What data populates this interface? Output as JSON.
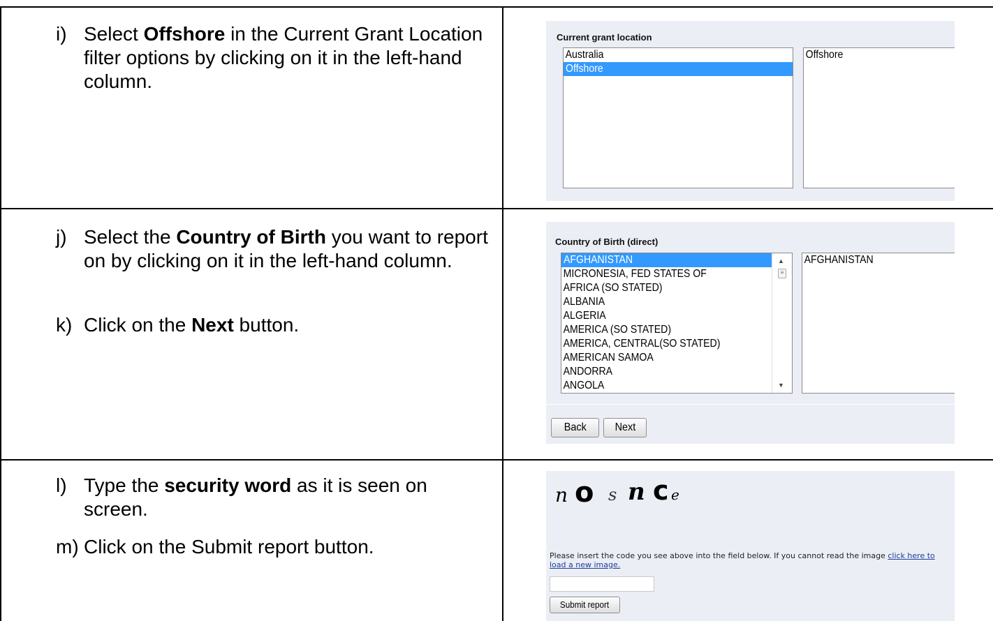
{
  "steps": {
    "i": {
      "label": "i)",
      "pre": "Select ",
      "bold": "Offshore",
      "post": " in the Current Grant Location filter options by clicking on it in the left-hand column."
    },
    "j": {
      "label": "j)",
      "pre": "Select the ",
      "bold": "Country of Birth",
      "post": " you want to report on by clicking on it in the left-hand column."
    },
    "k": {
      "label": "k)",
      "pre": "Click on the ",
      "bold": "Next",
      "post": " button."
    },
    "l": {
      "label": "l)",
      "pre": "Type the ",
      "bold": "security word",
      "post": " as it is seen on screen."
    },
    "m": {
      "label": "m)",
      "text": "Click on the Submit report button."
    }
  },
  "grant_location": {
    "title": "Current grant location",
    "options": [
      "Australia",
      "Offshore"
    ],
    "selected_index": 1,
    "chosen": [
      "Offshore"
    ]
  },
  "country_of_birth": {
    "title": "Country of Birth (direct)",
    "options": [
      "AFGHANISTAN",
      "MICRONESIA, FED STATES OF",
      "AFRICA (SO STATED)",
      "ALBANIA",
      "ALGERIA",
      "AMERICA (SO STATED)",
      "AMERICA, CENTRAL(SO STATED)",
      "AMERICAN SAMOA",
      "ANDORRA",
      "ANGOLA"
    ],
    "selected_index": 0,
    "chosen": [
      "AFGHANISTAN"
    ],
    "back_label": "Back",
    "next_label": "Next"
  },
  "security": {
    "captcha_glyphs": [
      "n",
      "o",
      "s",
      "n",
      "c",
      "e"
    ],
    "hint_pre": "Please insert the code you see above into the field below. If you cannot read the image ",
    "hint_link": "click here to load a new image.",
    "input_value": "",
    "submit_label": "Submit report"
  },
  "colors": {
    "selection": "#3399ff",
    "panel_bg": "#eceef6",
    "link": "#1a3d9a"
  }
}
